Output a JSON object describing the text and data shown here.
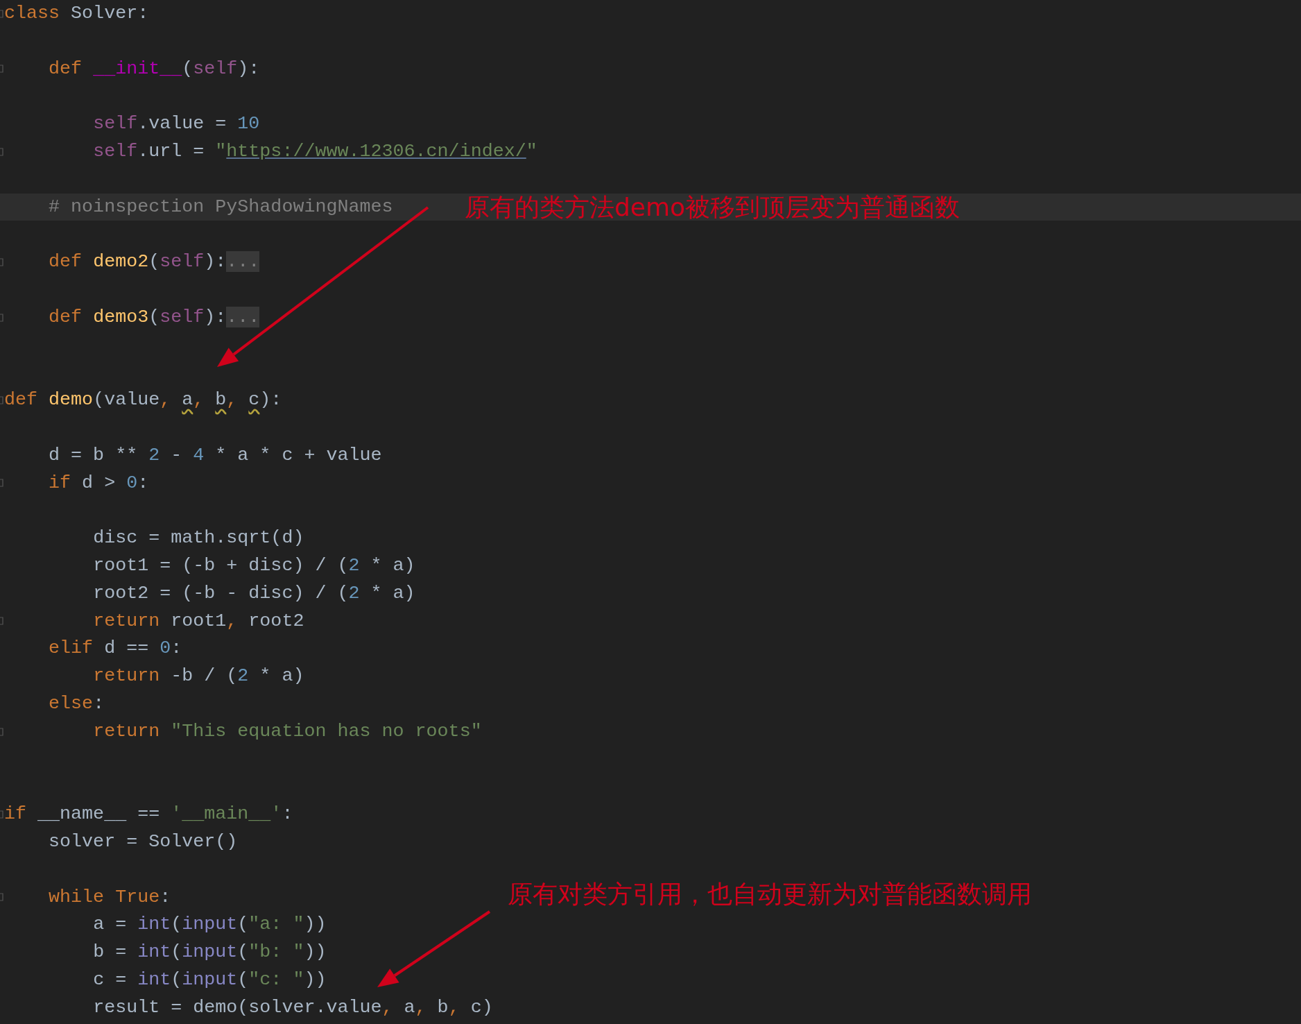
{
  "editor": {
    "lines": [
      {
        "kind": "code",
        "fold": true,
        "tokens": [
          {
            "text": "class",
            "kind": "keyword"
          },
          {
            "text": " Solver:",
            "kind": "plain"
          }
        ]
      },
      {
        "kind": "blank"
      },
      {
        "kind": "code",
        "fold": true,
        "tokens": [
          {
            "text": "    def ",
            "kind": "keyword"
          },
          {
            "text": "__init__",
            "kind": "magic"
          },
          {
            "text": "(",
            "kind": "plain"
          },
          {
            "text": "self",
            "kind": "self"
          },
          {
            "text": "):",
            "kind": "plain"
          }
        ]
      },
      {
        "kind": "blank"
      },
      {
        "kind": "code",
        "fold": false,
        "tokens": [
          {
            "text": "        self",
            "kind": "self"
          },
          {
            "text": ".value = ",
            "kind": "plain"
          },
          {
            "text": "10",
            "kind": "number"
          }
        ]
      },
      {
        "kind": "code",
        "fold": true,
        "tokens": [
          {
            "text": "        self",
            "kind": "self"
          },
          {
            "text": ".url = ",
            "kind": "plain"
          },
          {
            "text": "\"",
            "kind": "string"
          },
          {
            "text": "https://www.12306.cn/index/",
            "kind": "link"
          },
          {
            "text": "\"",
            "kind": "string"
          }
        ]
      },
      {
        "kind": "blank"
      },
      {
        "kind": "code",
        "fold": false,
        "highlighted": true,
        "tokens": [
          {
            "text": "    # noinspection PyShadowingNames",
            "kind": "comment"
          }
        ]
      },
      {
        "kind": "blank"
      },
      {
        "kind": "code",
        "fold": true,
        "tokens": [
          {
            "text": "    def ",
            "kind": "keyword"
          },
          {
            "text": "demo2",
            "kind": "function"
          },
          {
            "text": "(",
            "kind": "plain"
          },
          {
            "text": "self",
            "kind": "self"
          },
          {
            "text": "):",
            "kind": "plain"
          },
          {
            "text": "...",
            "kind": "folded"
          }
        ]
      },
      {
        "kind": "blank"
      },
      {
        "kind": "code",
        "fold": true,
        "tokens": [
          {
            "text": "    def ",
            "kind": "keyword"
          },
          {
            "text": "demo3",
            "kind": "function"
          },
          {
            "text": "(",
            "kind": "plain"
          },
          {
            "text": "self",
            "kind": "self"
          },
          {
            "text": "):",
            "kind": "plain"
          },
          {
            "text": "...",
            "kind": "folded"
          }
        ]
      },
      {
        "kind": "blank"
      },
      {
        "kind": "blank"
      },
      {
        "kind": "code",
        "fold": true,
        "tokens": [
          {
            "text": "def ",
            "kind": "keyword"
          },
          {
            "text": "demo",
            "kind": "function"
          },
          {
            "text": "(value",
            "kind": "plain"
          },
          {
            "text": ", ",
            "kind": "punct"
          },
          {
            "text": "a",
            "kind": "warning"
          },
          {
            "text": ", ",
            "kind": "punct"
          },
          {
            "text": "b",
            "kind": "warning"
          },
          {
            "text": ", ",
            "kind": "punct"
          },
          {
            "text": "c",
            "kind": "warning"
          },
          {
            "text": "):",
            "kind": "plain"
          }
        ]
      },
      {
        "kind": "blank"
      },
      {
        "kind": "code",
        "fold": false,
        "tokens": [
          {
            "text": "    d = b ** ",
            "kind": "plain"
          },
          {
            "text": "2",
            "kind": "number"
          },
          {
            "text": " - ",
            "kind": "plain"
          },
          {
            "text": "4",
            "kind": "number"
          },
          {
            "text": " * a * c + value",
            "kind": "plain"
          }
        ]
      },
      {
        "kind": "code",
        "fold": true,
        "tokens": [
          {
            "text": "    if",
            "kind": "keyword"
          },
          {
            "text": " d > ",
            "kind": "plain"
          },
          {
            "text": "0",
            "kind": "number"
          },
          {
            "text": ":",
            "kind": "plain"
          }
        ]
      },
      {
        "kind": "blank"
      },
      {
        "kind": "code",
        "fold": false,
        "tokens": [
          {
            "text": "        disc = math.sqrt(d)",
            "kind": "plain"
          }
        ]
      },
      {
        "kind": "code",
        "fold": false,
        "tokens": [
          {
            "text": "        root1 = (-b + disc) / (",
            "kind": "plain"
          },
          {
            "text": "2",
            "kind": "number"
          },
          {
            "text": " * a)",
            "kind": "plain"
          }
        ]
      },
      {
        "kind": "code",
        "fold": false,
        "tokens": [
          {
            "text": "        root2 = (-b - disc) / (",
            "kind": "plain"
          },
          {
            "text": "2",
            "kind": "number"
          },
          {
            "text": " * a)",
            "kind": "plain"
          }
        ]
      },
      {
        "kind": "code",
        "fold": true,
        "tokens": [
          {
            "text": "        return",
            "kind": "keyword"
          },
          {
            "text": " root1",
            "kind": "plain"
          },
          {
            "text": ",",
            "kind": "punct"
          },
          {
            "text": " root2",
            "kind": "plain"
          }
        ]
      },
      {
        "kind": "code",
        "fold": false,
        "tokens": [
          {
            "text": "    elif",
            "kind": "keyword"
          },
          {
            "text": " d == ",
            "kind": "plain"
          },
          {
            "text": "0",
            "kind": "number"
          },
          {
            "text": ":",
            "kind": "plain"
          }
        ]
      },
      {
        "kind": "code",
        "fold": false,
        "tokens": [
          {
            "text": "        return",
            "kind": "keyword"
          },
          {
            "text": " -b / (",
            "kind": "plain"
          },
          {
            "text": "2",
            "kind": "number"
          },
          {
            "text": " * a)",
            "kind": "plain"
          }
        ]
      },
      {
        "kind": "code",
        "fold": false,
        "tokens": [
          {
            "text": "    else",
            "kind": "keyword"
          },
          {
            "text": ":",
            "kind": "plain"
          }
        ]
      },
      {
        "kind": "code",
        "fold": true,
        "tokens": [
          {
            "text": "        return ",
            "kind": "keyword"
          },
          {
            "text": "\"This equation has no roots\"",
            "kind": "string"
          }
        ]
      },
      {
        "kind": "blank"
      },
      {
        "kind": "blank"
      },
      {
        "kind": "code",
        "fold": true,
        "tokens": [
          {
            "text": "if",
            "kind": "keyword"
          },
          {
            "text": " __name__ == ",
            "kind": "plain"
          },
          {
            "text": "'__main__'",
            "kind": "string"
          },
          {
            "text": ":",
            "kind": "plain"
          }
        ]
      },
      {
        "kind": "code",
        "fold": false,
        "tokens": [
          {
            "text": "    solver = Solver()",
            "kind": "plain"
          }
        ]
      },
      {
        "kind": "blank"
      },
      {
        "kind": "code",
        "fold": true,
        "tokens": [
          {
            "text": "    while True",
            "kind": "keyword"
          },
          {
            "text": ":",
            "kind": "plain"
          }
        ]
      },
      {
        "kind": "code",
        "fold": false,
        "tokens": [
          {
            "text": "        a = ",
            "kind": "plain"
          },
          {
            "text": "int",
            "kind": "builtin"
          },
          {
            "text": "(",
            "kind": "plain"
          },
          {
            "text": "input",
            "kind": "builtin"
          },
          {
            "text": "(",
            "kind": "plain"
          },
          {
            "text": "\"a: \"",
            "kind": "string"
          },
          {
            "text": "))",
            "kind": "plain"
          }
        ]
      },
      {
        "kind": "code",
        "fold": false,
        "tokens": [
          {
            "text": "        b = ",
            "kind": "plain"
          },
          {
            "text": "int",
            "kind": "builtin"
          },
          {
            "text": "(",
            "kind": "plain"
          },
          {
            "text": "input",
            "kind": "builtin"
          },
          {
            "text": "(",
            "kind": "plain"
          },
          {
            "text": "\"b: \"",
            "kind": "string"
          },
          {
            "text": "))",
            "kind": "plain"
          }
        ]
      },
      {
        "kind": "code",
        "fold": false,
        "tokens": [
          {
            "text": "        c = ",
            "kind": "plain"
          },
          {
            "text": "int",
            "kind": "builtin"
          },
          {
            "text": "(",
            "kind": "plain"
          },
          {
            "text": "input",
            "kind": "builtin"
          },
          {
            "text": "(",
            "kind": "plain"
          },
          {
            "text": "\"c: \"",
            "kind": "string"
          },
          {
            "text": "))",
            "kind": "plain"
          }
        ]
      },
      {
        "kind": "code",
        "fold": false,
        "tokens": [
          {
            "text": "        result = demo(solver.value",
            "kind": "plain"
          },
          {
            "text": ",",
            "kind": "punct"
          },
          {
            "text": " a",
            "kind": "plain"
          },
          {
            "text": ",",
            "kind": "punct"
          },
          {
            "text": " b",
            "kind": "plain"
          },
          {
            "text": ",",
            "kind": "punct"
          },
          {
            "text": " c)",
            "kind": "plain"
          }
        ]
      }
    ]
  },
  "annotations": [
    {
      "text": "原有的类方法demo被移到顶层变为普通函数"
    },
    {
      "text": "原有对类方引用，也自动更新为对普能函数调用"
    }
  ]
}
